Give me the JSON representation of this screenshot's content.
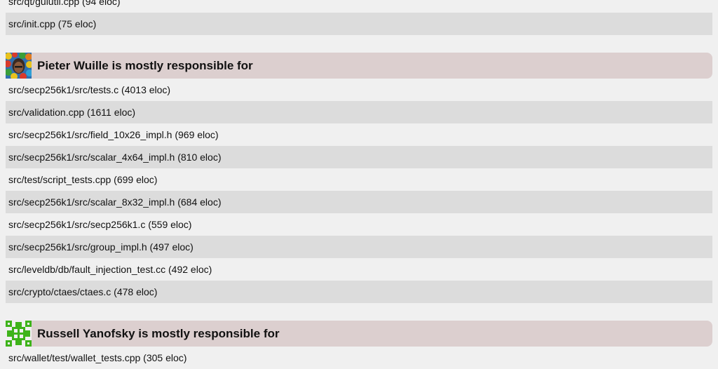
{
  "sections": [
    {
      "files": [
        "src/qt/guiutil.cpp (94 eloc)",
        "src/init.cpp (75 eloc)"
      ]
    },
    {
      "title": "Pieter Wuille is mostly responsible for",
      "avatar_icon": "pieter-wuille-avatar-icon",
      "files": [
        "src/secp256k1/src/tests.c (4013 eloc)",
        "src/validation.cpp (1611 eloc)",
        "src/secp256k1/src/field_10x26_impl.h (969 eloc)",
        "src/secp256k1/src/scalar_4x64_impl.h (810 eloc)",
        "src/test/script_tests.cpp (699 eloc)",
        "src/secp256k1/src/scalar_8x32_impl.h (684 eloc)",
        "src/secp256k1/src/secp256k1.c (559 eloc)",
        "src/secp256k1/src/group_impl.h (497 eloc)",
        "src/leveldb/db/fault_injection_test.cc (492 eloc)",
        "src/crypto/ctaes/ctaes.c (478 eloc)"
      ]
    },
    {
      "title": "Russell Yanofsky is mostly responsible for",
      "avatar_icon": "russell-yanofsky-identicon-icon",
      "files": [
        "src/wallet/test/wallet_tests.cpp (305 eloc)"
      ]
    }
  ],
  "colors": {
    "page_background": "#f0f0f0",
    "alt_row_background": "#dcdcdc",
    "header_background": "#dccfcf",
    "identicon_green": "#3eb31a"
  }
}
